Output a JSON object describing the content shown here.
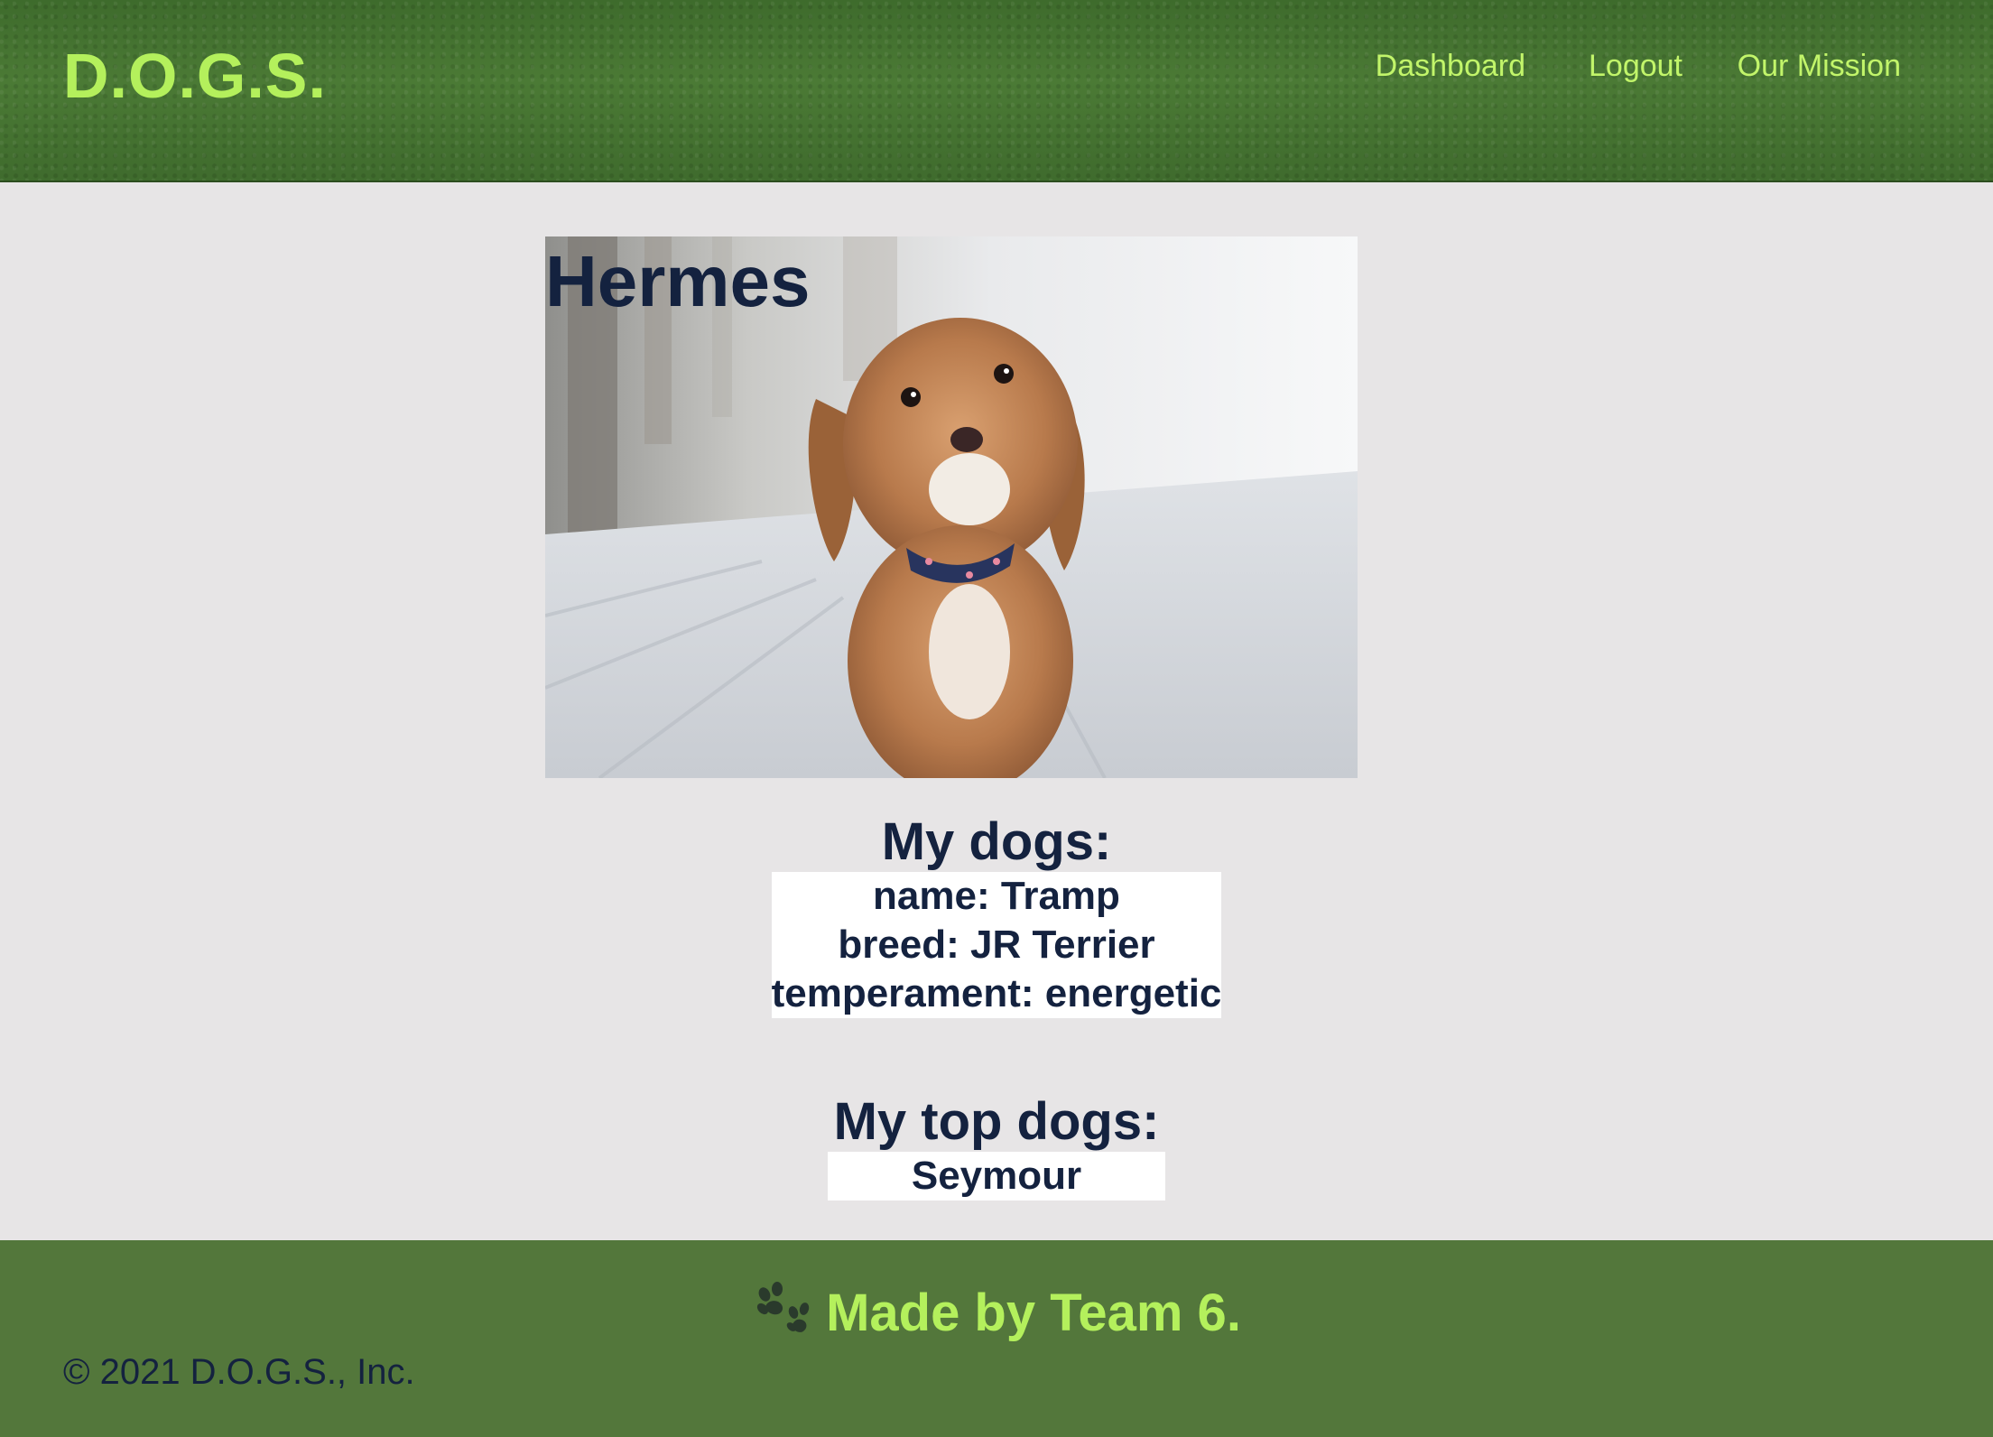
{
  "brand": {
    "logo": "D.O.G.S."
  },
  "nav": {
    "dashboard": "Dashboard",
    "logout": "Logout",
    "mission": "Our Mission"
  },
  "profile": {
    "name": "Hermes",
    "photo_icon": "dog-photo"
  },
  "my_dogs": {
    "title": "My dogs:",
    "lines": [
      "name: Tramp",
      "breed: JR Terrier",
      "temperament: energetic"
    ]
  },
  "top_dogs": {
    "title": "My top dogs:",
    "names": [
      "Seymour"
    ]
  },
  "footer": {
    "paw_icon": "paw-icon",
    "made_by": "Made by Team 6.",
    "copyright": "© 2021 D.O.G.S., Inc."
  },
  "colors": {
    "accent_green": "#b4f05c",
    "header_green": "#4b7a35",
    "footer_green": "#53773b",
    "navy_text": "#14223f",
    "page_bg": "#e7e5e6"
  }
}
